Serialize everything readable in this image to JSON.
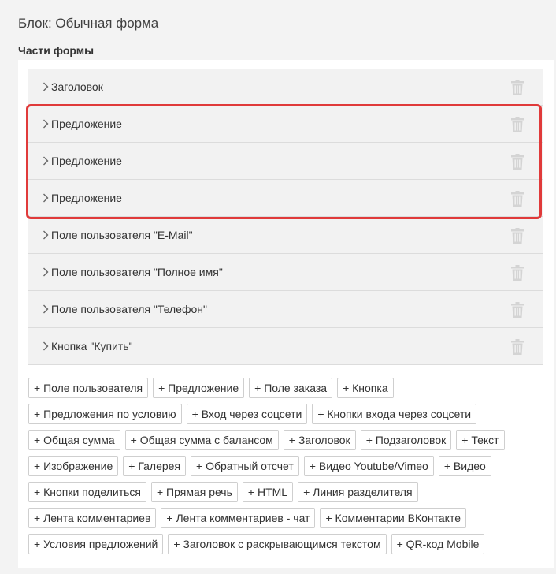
{
  "block": {
    "title": "Блок: Обычная форма"
  },
  "form_parts": {
    "heading": "Части формы",
    "items": [
      {
        "label": "Заголовок"
      },
      {
        "label": "Предложение"
      },
      {
        "label": "Предложение"
      },
      {
        "label": "Предложение"
      },
      {
        "label": "Поле пользователя \"E-Mail\""
      },
      {
        "label": "Поле пользователя \"Полное имя\""
      },
      {
        "label": "Поле пользователя \"Телефон\""
      },
      {
        "label": "Кнопка \"Купить\""
      }
    ]
  },
  "add_buttons": [
    [
      "+ Поле пользователя",
      "+ Предложение",
      "+ Поле заказа",
      "+ Кнопка"
    ],
    [
      "+ Предложения по условию",
      "+ Вход через соцсети",
      "+ Кнопки входа через соцсети"
    ],
    [
      "+ Общая сумма",
      "+ Общая сумма с балансом",
      "+ Заголовок",
      "+ Подзаголовок",
      "+ Текст"
    ],
    [
      "+ Изображение",
      "+ Галерея",
      "+ Обратный отсчет",
      "+ Видео Youtube/Vimeo",
      "+ Видео"
    ],
    [
      "+ Кнопки поделиться",
      "+ Прямая речь",
      "+ HTML",
      "+ Линия разделителя"
    ],
    [
      "+ Лента комментариев",
      "+ Лента комментариев - чат",
      "+ Комментарии ВКонтакте"
    ],
    [
      "+ Условия предложений",
      "+ Заголовок с раскрывающимся текстом",
      "+ QR-код Mobile"
    ]
  ],
  "colors": {
    "highlight": "#e03a3a",
    "part_bg": "#f2f2f2",
    "page_bg": "#f3f3f3"
  },
  "icons": {
    "expand": "chevron-right-icon",
    "delete": "trash-icon"
  }
}
